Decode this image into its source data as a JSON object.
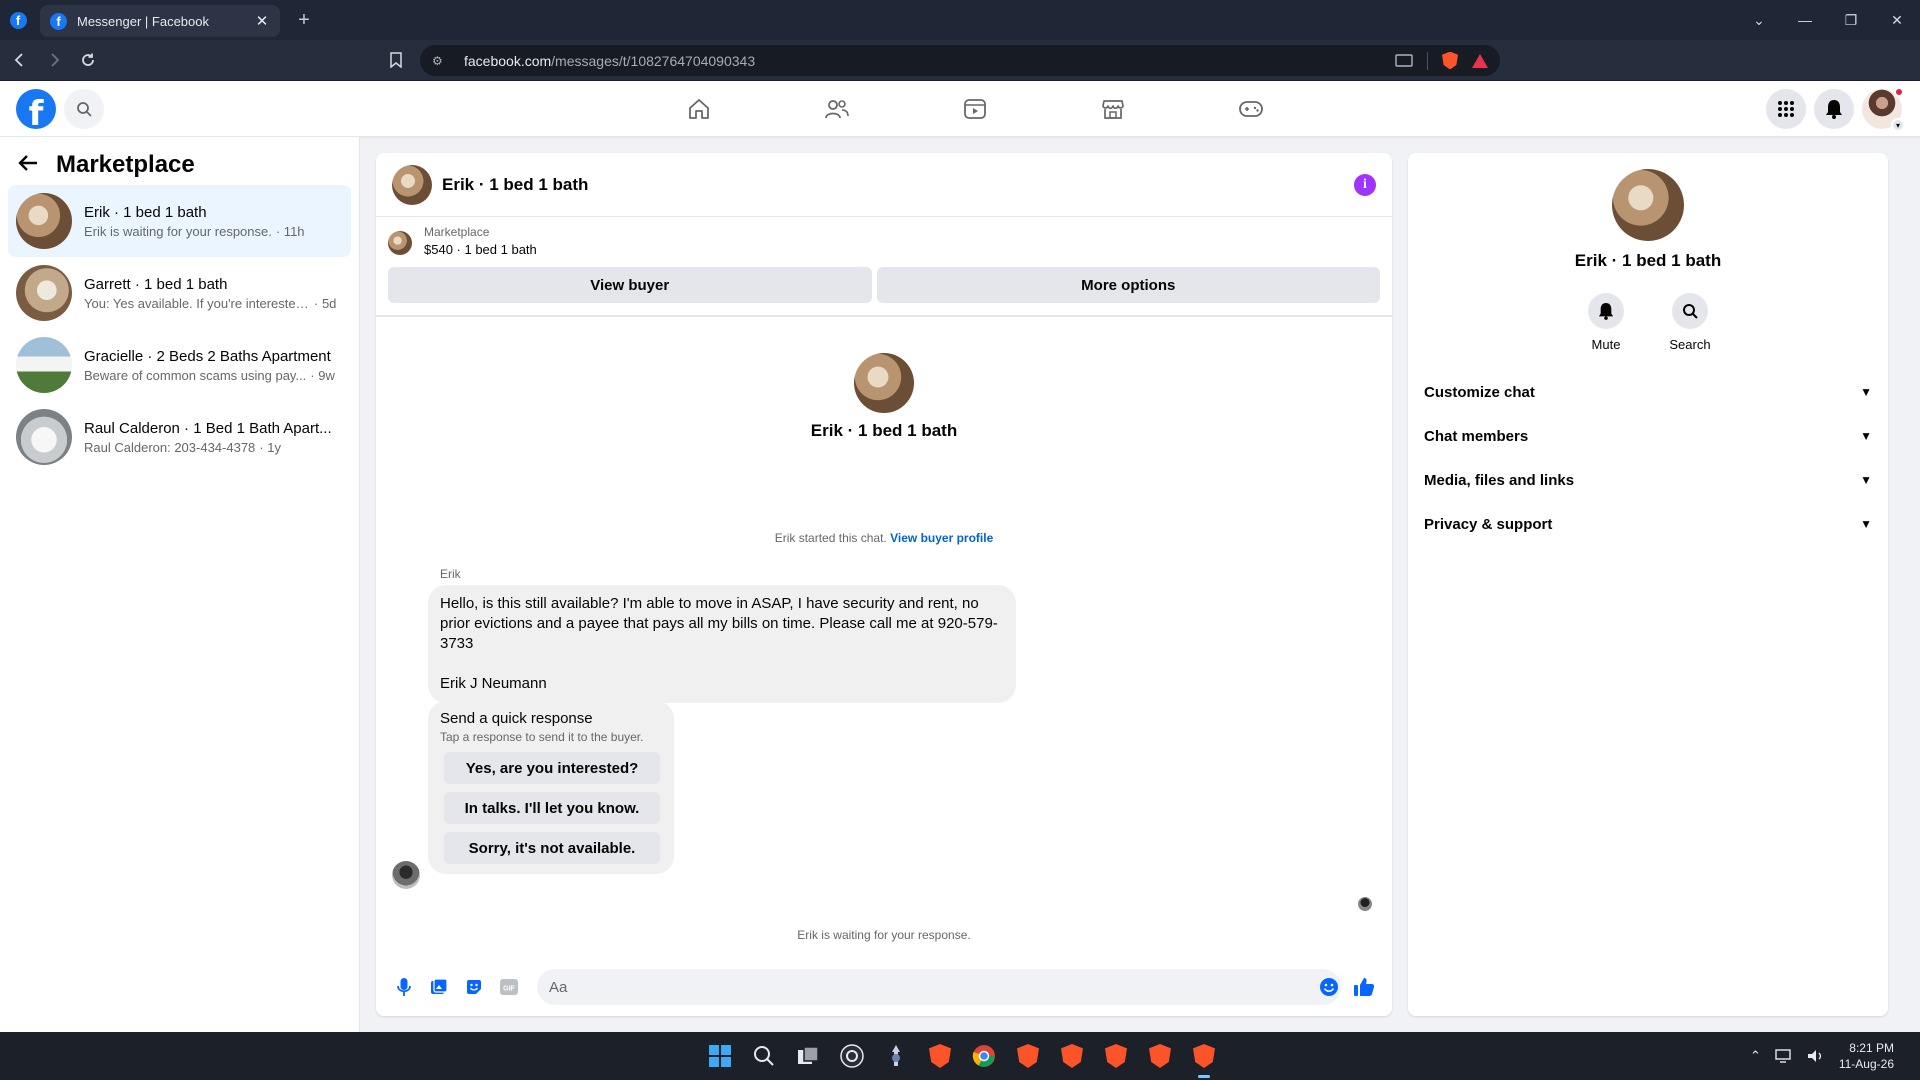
{
  "browser": {
    "tab_title": "Messenger | Facebook",
    "url_host": "facebook.com",
    "url_path": "/messages/t/1082764704090343"
  },
  "left": {
    "title": "Marketplace",
    "conversations": [
      {
        "name": "Erik · 1 bed 1 bath",
        "message": "Erik is waiting for your response.",
        "age": "· 11h",
        "thumb": "room1"
      },
      {
        "name": "Garrett · 1 bed 1 bath",
        "message": "You: Yes available. If you're interested,...",
        "age": "· 5d",
        "thumb": "room2"
      },
      {
        "name": "Gracielle · 2 Beds 2 Baths Apartment",
        "message": "Beware of common scams using pay...",
        "age": "· 9w",
        "thumb": "house"
      },
      {
        "name": "Raul Calderon · 1 Bed 1 Bath Apart...",
        "message": "Raul Calderon: 203-434-4378",
        "age": "· 1y",
        "thumb": "bath"
      }
    ]
  },
  "chat": {
    "title": "Erik · 1 bed 1 bath",
    "listing_label": "Marketplace",
    "listing_value": "$540 · 1 bed 1 bath",
    "view_buyer": "View buyer",
    "more_options": "More options",
    "intro_name": "Erik · 1 bed 1 bath",
    "started_text": "Erik started this chat.",
    "view_buyer_profile": "View buyer profile",
    "sender": "Erik",
    "message_body": "Hello, is this still available? I'm able to move in ASAP, I have security and rent, no prior evictions and a payee that pays all my bills on time. Please call me at 920-579-3733",
    "message_signature": "Erik J Neumann",
    "quick_title": "Send a quick response",
    "quick_subtitle": "Tap a response to send it to the buyer.",
    "quick_responses": [
      "Yes, are you interested?",
      "In talks. I'll let you know.",
      "Sorry, it's not available."
    ],
    "waiting": "Erik is waiting for your response.",
    "input_placeholder": "Aa"
  },
  "details": {
    "name": "Erik · 1 bed 1 bath",
    "mute_label": "Mute",
    "search_label": "Search",
    "sections": [
      "Customize chat",
      "Chat members",
      "Media, files and links",
      "Privacy & support"
    ]
  },
  "taskbar": {
    "time": "8:21 PM",
    "date": "11-Aug-26"
  },
  "colors": {
    "facebook_blue": "#1877f2",
    "active_conversation": "#ebf5ff",
    "info_purple": "#a033ff",
    "link_blue": "#0064d1"
  }
}
